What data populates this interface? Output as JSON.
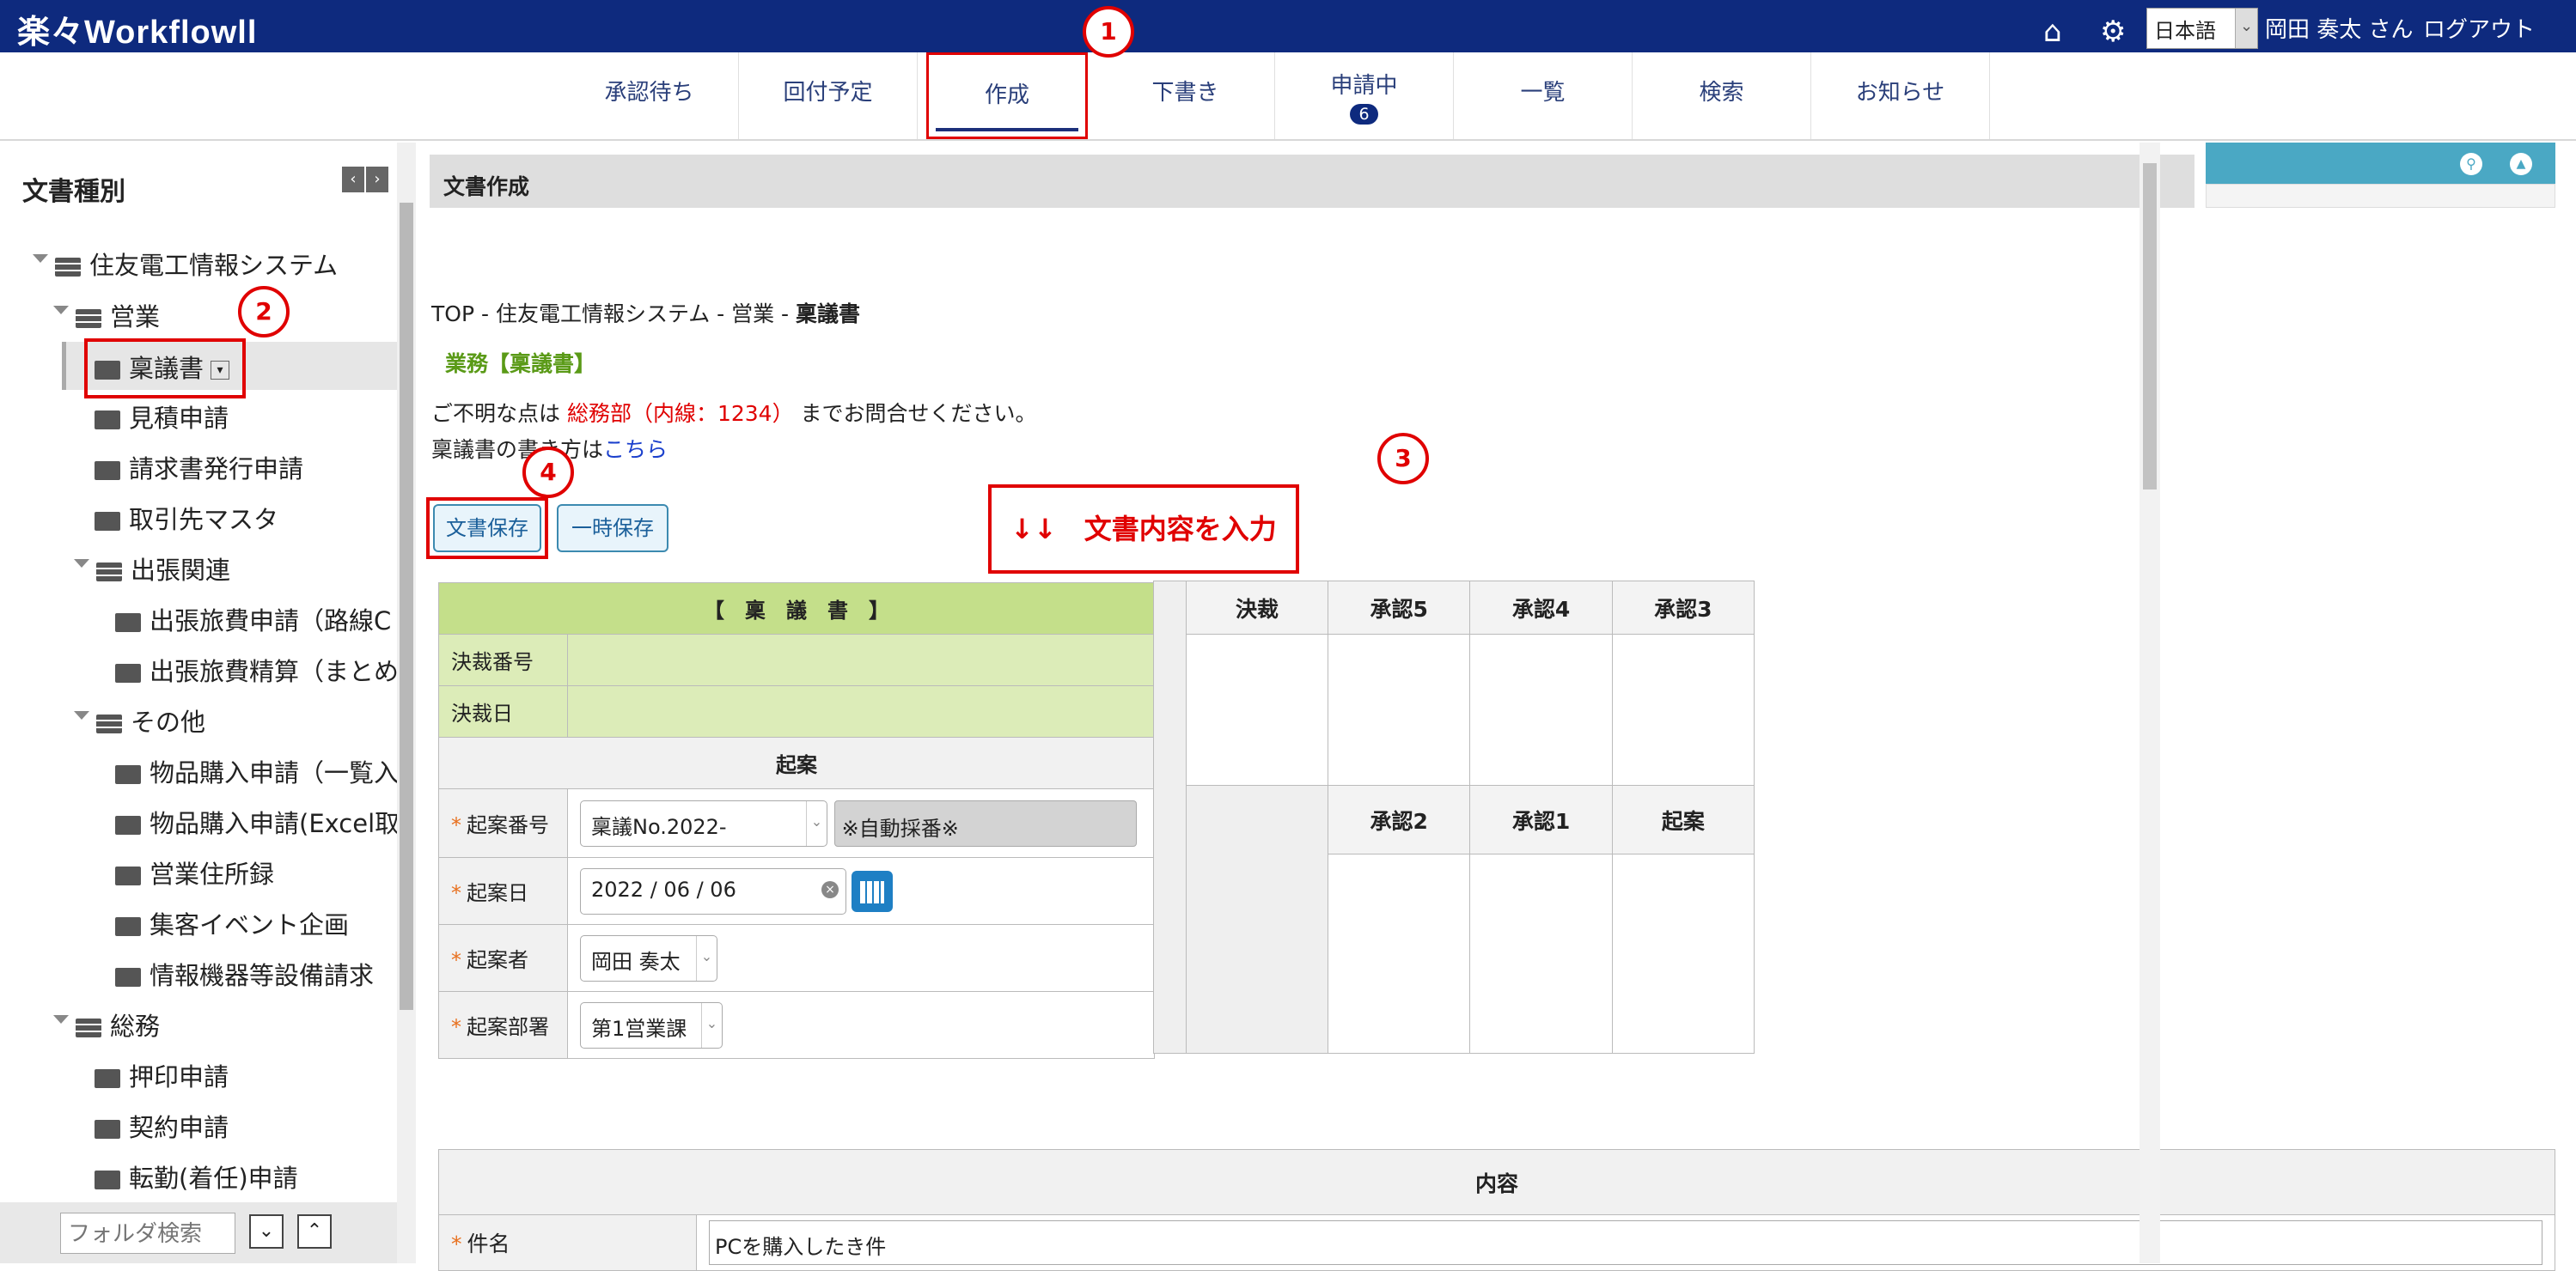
{
  "app": {
    "logo": "楽々Workflowll"
  },
  "top": {
    "lang": "日本語",
    "user": "岡田 奏太 さん",
    "logout": "ログアウト"
  },
  "tabs": [
    {
      "label": "承認待ち"
    },
    {
      "label": "回付予定"
    },
    {
      "label": "作成"
    },
    {
      "label": "下書き"
    },
    {
      "label": "申請中",
      "badge": "6"
    },
    {
      "label": "一覧"
    },
    {
      "label": "検索"
    },
    {
      "label": "お知らせ"
    }
  ],
  "callouts": [
    "1",
    "2",
    "3",
    "4"
  ],
  "sidebar": {
    "title": "文書種別",
    "tree": [
      {
        "label": "住友電工情報システム"
      },
      {
        "label": "営業"
      },
      {
        "label": "稟議書"
      },
      {
        "label": "見積申請"
      },
      {
        "label": "請求書発行申請"
      },
      {
        "label": "取引先マスタ"
      },
      {
        "label": "出張関連"
      },
      {
        "label": "出張旅費申請（路線C"
      },
      {
        "label": "出張旅費精算（まとめ"
      },
      {
        "label": "その他"
      },
      {
        "label": "物品購入申請（一覧入"
      },
      {
        "label": "物品購入申請(Excel取"
      },
      {
        "label": "営業住所録"
      },
      {
        "label": "集客イベント企画"
      },
      {
        "label": "情報機器等設備請求"
      },
      {
        "label": "総務"
      },
      {
        "label": "押印申請"
      },
      {
        "label": "契約申請"
      },
      {
        "label": "転勤(着任)申請"
      }
    ],
    "folder_search_placeholder": "フォルダ検索"
  },
  "main": {
    "header": "文書作成",
    "breadcrumb_prefix": "TOP - 住友電工情報システム - 営業 - ",
    "breadcrumb_current": "稟議書",
    "category": "業務【稟議書】",
    "contact_pre": "ご不明な点は",
    "contact_dept": "総務部（内線：1234）",
    "contact_post": "までお問合せください。",
    "howto_pre": "稟議書の書き方は",
    "howto_link": "こちら",
    "save_button": "文書保存",
    "temp_save_button": "一時保存",
    "instruction": "↓↓　文書内容を入力　↓↓"
  },
  "form": {
    "title": "【　稟　議　書　】",
    "decision_no_label": "決裁番号",
    "decision_date_label": "決裁日",
    "draft_section": "起案",
    "draft_no_label": "起案番号",
    "draft_no_value": "稟議No.2022-",
    "draft_no_auto": "※自動採番※",
    "draft_date_label": "起案日",
    "draft_date_value": "2022 / 06 / 06",
    "drafter_label": "起案者",
    "drafter_value": "岡田 奏太",
    "dept_label": "起案部署",
    "dept_value": "第1営業課"
  },
  "approval": {
    "top": [
      "決裁",
      "承認5",
      "承認4",
      "承認3"
    ],
    "bottom": [
      "承認2",
      "承認1",
      "起案"
    ]
  },
  "content": {
    "section": "内容",
    "subject_label": "件名",
    "subject_value": "PCを購入したき件"
  }
}
